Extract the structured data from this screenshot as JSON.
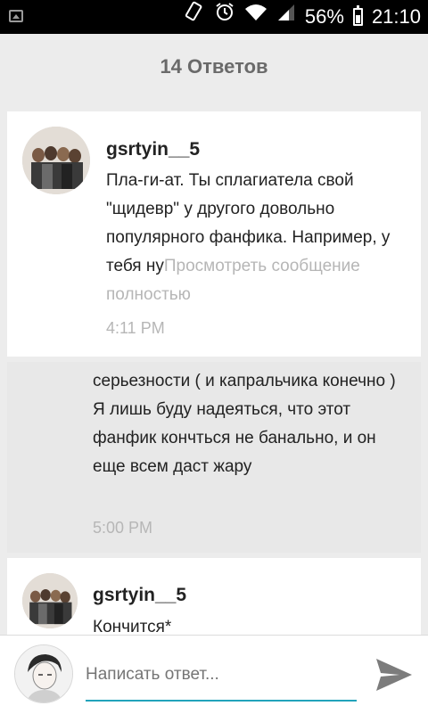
{
  "status_bar": {
    "battery": "56%",
    "time": "21:10"
  },
  "header": {
    "title": "14 Ответов"
  },
  "comments": [
    {
      "author": "gsrtyin__5",
      "text": "Пла-ги-ат.  Ты сплагиатела свой \"щидевр\" у другого довольно популярного фанфика. Например, у тебя ну",
      "more_label": "Просмотреть сообщение полностью",
      "time": "4:11 PM"
    },
    {
      "text": "серьезности ( и капральчика конечно ) Я лишь буду надеяться, что этот фанфик кончться не банально,  и он еще всем даст жару",
      "time": "5:00 PM"
    },
    {
      "author": "gsrtyin__5",
      "text": "Кончится*"
    }
  ],
  "reply": {
    "placeholder": "Написать ответ..."
  },
  "colors": {
    "accent": "#22a3bb",
    "background": "#ececec",
    "muted_text": "#b6b6b6"
  }
}
